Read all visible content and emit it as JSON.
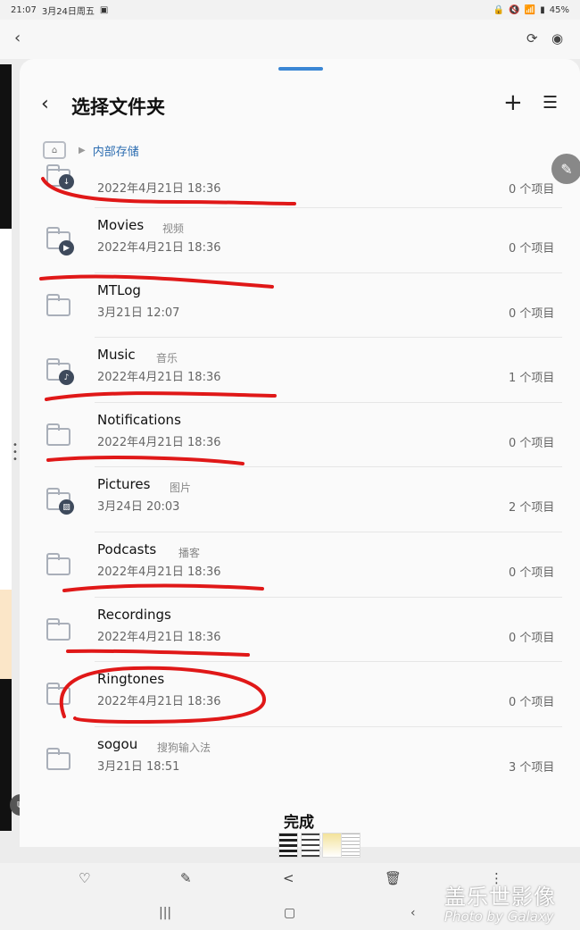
{
  "status_bar": {
    "time": "21:07",
    "date": "3月24日周五",
    "battery": "45%"
  },
  "icons": {
    "viewer_back": "chevron-left-icon",
    "sync": "sync-icon",
    "eye": "eye-icon",
    "back": "chevron-left-icon",
    "add": "plus-icon",
    "sort": "sort-icon",
    "home": "home-icon",
    "edit": "pencil-icon"
  },
  "sheet": {
    "title": "选择文件夹",
    "breadcrumb": "内部存储",
    "done_label": "完成"
  },
  "folders": [
    {
      "name": "",
      "subtitle": "",
      "date": "2022年4月21日 18:36",
      "count": "0 个项目",
      "badge": "download-icon"
    },
    {
      "name": "Movies",
      "subtitle": "视频",
      "date": "2022年4月21日 18:36",
      "count": "0 个项目",
      "badge": "play-icon"
    },
    {
      "name": "MTLog",
      "subtitle": "",
      "date": "3月21日 12:07",
      "count": "0 个项目",
      "badge": ""
    },
    {
      "name": "Music",
      "subtitle": "音乐",
      "date": "2022年4月21日 18:36",
      "count": "1 个项目",
      "badge": "music-note-icon"
    },
    {
      "name": "Notifications",
      "subtitle": "",
      "date": "2022年4月21日 18:36",
      "count": "0 个项目",
      "badge": ""
    },
    {
      "name": "Pictures",
      "subtitle": "图片",
      "date": "3月24日 20:03",
      "count": "2 个项目",
      "badge": "image-icon"
    },
    {
      "name": "Podcasts",
      "subtitle": "播客",
      "date": "2022年4月21日 18:36",
      "count": "0 个项目",
      "badge": ""
    },
    {
      "name": "Recordings",
      "subtitle": "",
      "date": "2022年4月21日 18:36",
      "count": "0 个项目",
      "badge": ""
    },
    {
      "name": "Ringtones",
      "subtitle": "",
      "date": "2022年4月21日 18:36",
      "count": "0 个项目",
      "badge": ""
    },
    {
      "name": "sogou",
      "subtitle": "搜狗输入法",
      "date": "3月21日 18:51",
      "count": "3 个项目",
      "badge": ""
    }
  ],
  "toolbar": {
    "items": [
      "heart-icon",
      "pencil-icon",
      "share-icon",
      "trash-icon",
      "more-icon"
    ]
  },
  "nav": {
    "items": [
      "recents-icon",
      "home-icon",
      "back-icon"
    ]
  },
  "watermark": {
    "main": "盖乐世影像",
    "sub": "Photo by Galaxy"
  },
  "colors": {
    "accent": "#2b6cb0",
    "annotation": "#e01818"
  }
}
